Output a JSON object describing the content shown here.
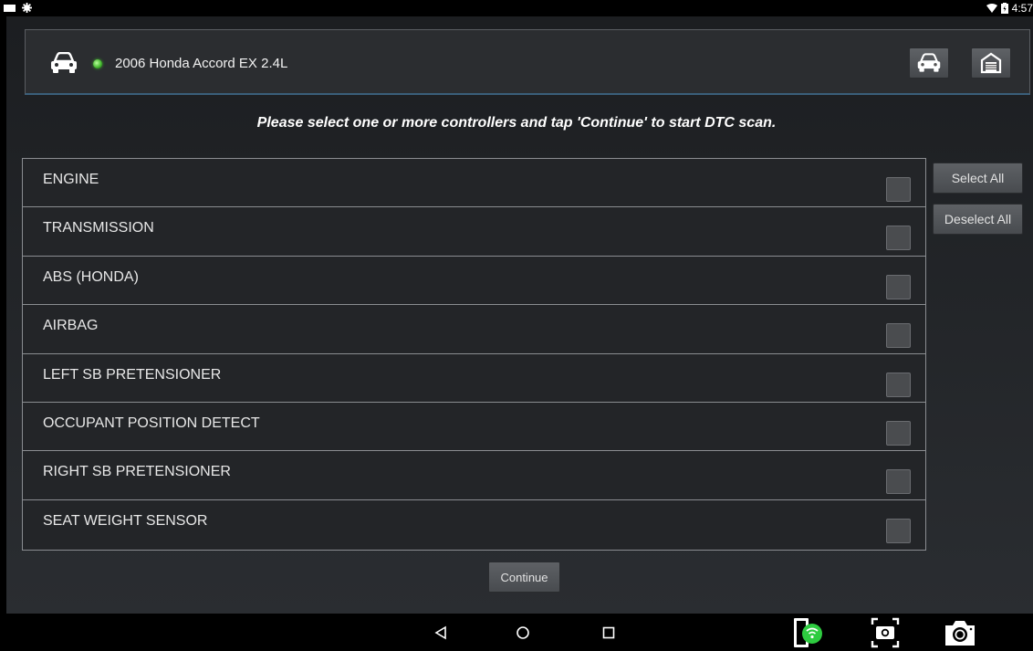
{
  "status_bar": {
    "time": "4:57"
  },
  "vehicle": {
    "name": "2006 Honda Accord EX 2.4L"
  },
  "instruction": "Please select one or more controllers and tap 'Continue' to start DTC scan.",
  "controllers": [
    {
      "label": "ENGINE",
      "checked": false
    },
    {
      "label": "TRANSMISSION",
      "checked": false
    },
    {
      "label": "ABS (HONDA)",
      "checked": false
    },
    {
      "label": "AIRBAG",
      "checked": false
    },
    {
      "label": "LEFT SB PRETENSIONER",
      "checked": false
    },
    {
      "label": "OCCUPANT POSITION DETECT",
      "checked": false
    },
    {
      "label": "RIGHT SB PRETENSIONER",
      "checked": false
    },
    {
      "label": "SEAT WEIGHT SENSOR",
      "checked": false
    }
  ],
  "buttons": {
    "select_all": "Select All",
    "deselect_all": "Deselect All",
    "continue": "Continue"
  },
  "icons": {
    "vehicle": "car-icon",
    "status_led": "green-led-icon",
    "vehicle_select": "car-icon",
    "home": "garage-icon",
    "nav_back": "back-triangle-icon",
    "nav_home": "home-circle-icon",
    "nav_recents": "recents-square-icon",
    "wifi_device": "phone-wifi-icon",
    "screenshot": "screenshot-icon",
    "camera": "camera-icon"
  },
  "colors": {
    "status_led": "#3fb52a",
    "wifi_badge": "#2ecc40"
  }
}
